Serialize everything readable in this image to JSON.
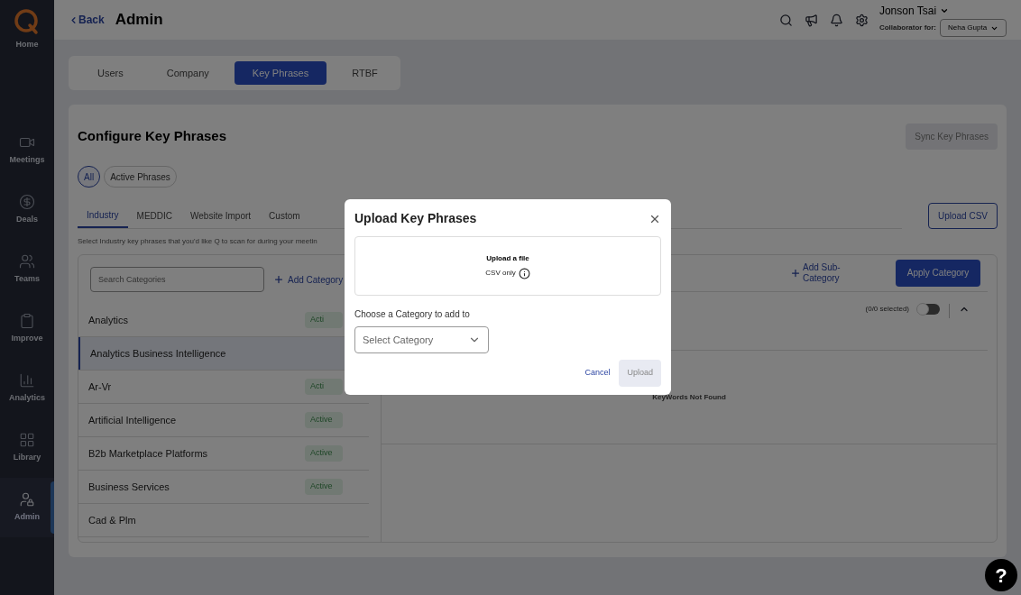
{
  "sidebar": {
    "items": [
      {
        "label": "Home",
        "selected": false
      },
      {
        "label": "Meetings",
        "selected": false
      },
      {
        "label": "Deals",
        "selected": false
      },
      {
        "label": "Teams",
        "selected": false
      },
      {
        "label": "Improve",
        "selected": false
      },
      {
        "label": "Analytics",
        "selected": false
      },
      {
        "label": "Library",
        "selected": false
      },
      {
        "label": "Admin",
        "selected": true
      }
    ]
  },
  "header": {
    "back": "Back",
    "title": "Admin",
    "user": "Jonson Tsai",
    "collaborator_label": "Collaborator for:",
    "collaborator": "Neha Gupta"
  },
  "tabs": [
    {
      "label": "Users",
      "selected": false
    },
    {
      "label": "Company",
      "selected": false
    },
    {
      "label": "Key Phrases",
      "selected": true
    },
    {
      "label": "RTBF",
      "selected": false
    }
  ],
  "configure": {
    "title": "Configure Key Phrases",
    "sync_button": "Sync Key Phrases",
    "filters": [
      {
        "label": "All",
        "selected": true
      },
      {
        "label": "Active Phrases",
        "selected": false
      }
    ],
    "subtabs": [
      {
        "label": "Industry",
        "selected": true
      },
      {
        "label": "MEDDIC",
        "selected": false
      },
      {
        "label": "Website Import",
        "selected": false
      },
      {
        "label": "Custom",
        "selected": false
      }
    ],
    "upload_csv": "Upload CSV",
    "description": "Select Industry key phrases that you'd like Q to scan for during your meetin",
    "search": {
      "placeholder": "Search Categories"
    },
    "add_category": "Add Category",
    "categories": [
      {
        "name": "Analytics",
        "status": "Acti",
        "selected": false
      },
      {
        "name": "Analytics Business Intelligence",
        "selected": true
      },
      {
        "name": "Ar-Vr",
        "status": "Acti",
        "selected": false
      },
      {
        "name": "Artificial Intelligence",
        "status": "Active",
        "selected": false
      },
      {
        "name": "B2b Marketplace Platforms",
        "status": "Active",
        "selected": false
      },
      {
        "name": "Business Services",
        "status": "Active",
        "selected": false
      },
      {
        "name": "Cad & Plm",
        "selected": false
      }
    ],
    "add_sub_category": "Add Sub-Category",
    "apply_category": "Apply Category",
    "selected_count": "(0/0 selected)",
    "toggle_on": false,
    "expanded": true,
    "empty": "KeyWords Not Found"
  },
  "modal": {
    "title": "Upload Key Phrases",
    "drop_title": "Upload a file",
    "drop_hint": "CSV only",
    "category_label": "Choose a Category to add to",
    "select": {
      "placeholder": "Select Category"
    },
    "cancel": "Cancel",
    "upload": {
      "label": "Upload",
      "disabled": true
    }
  },
  "help": "?"
}
